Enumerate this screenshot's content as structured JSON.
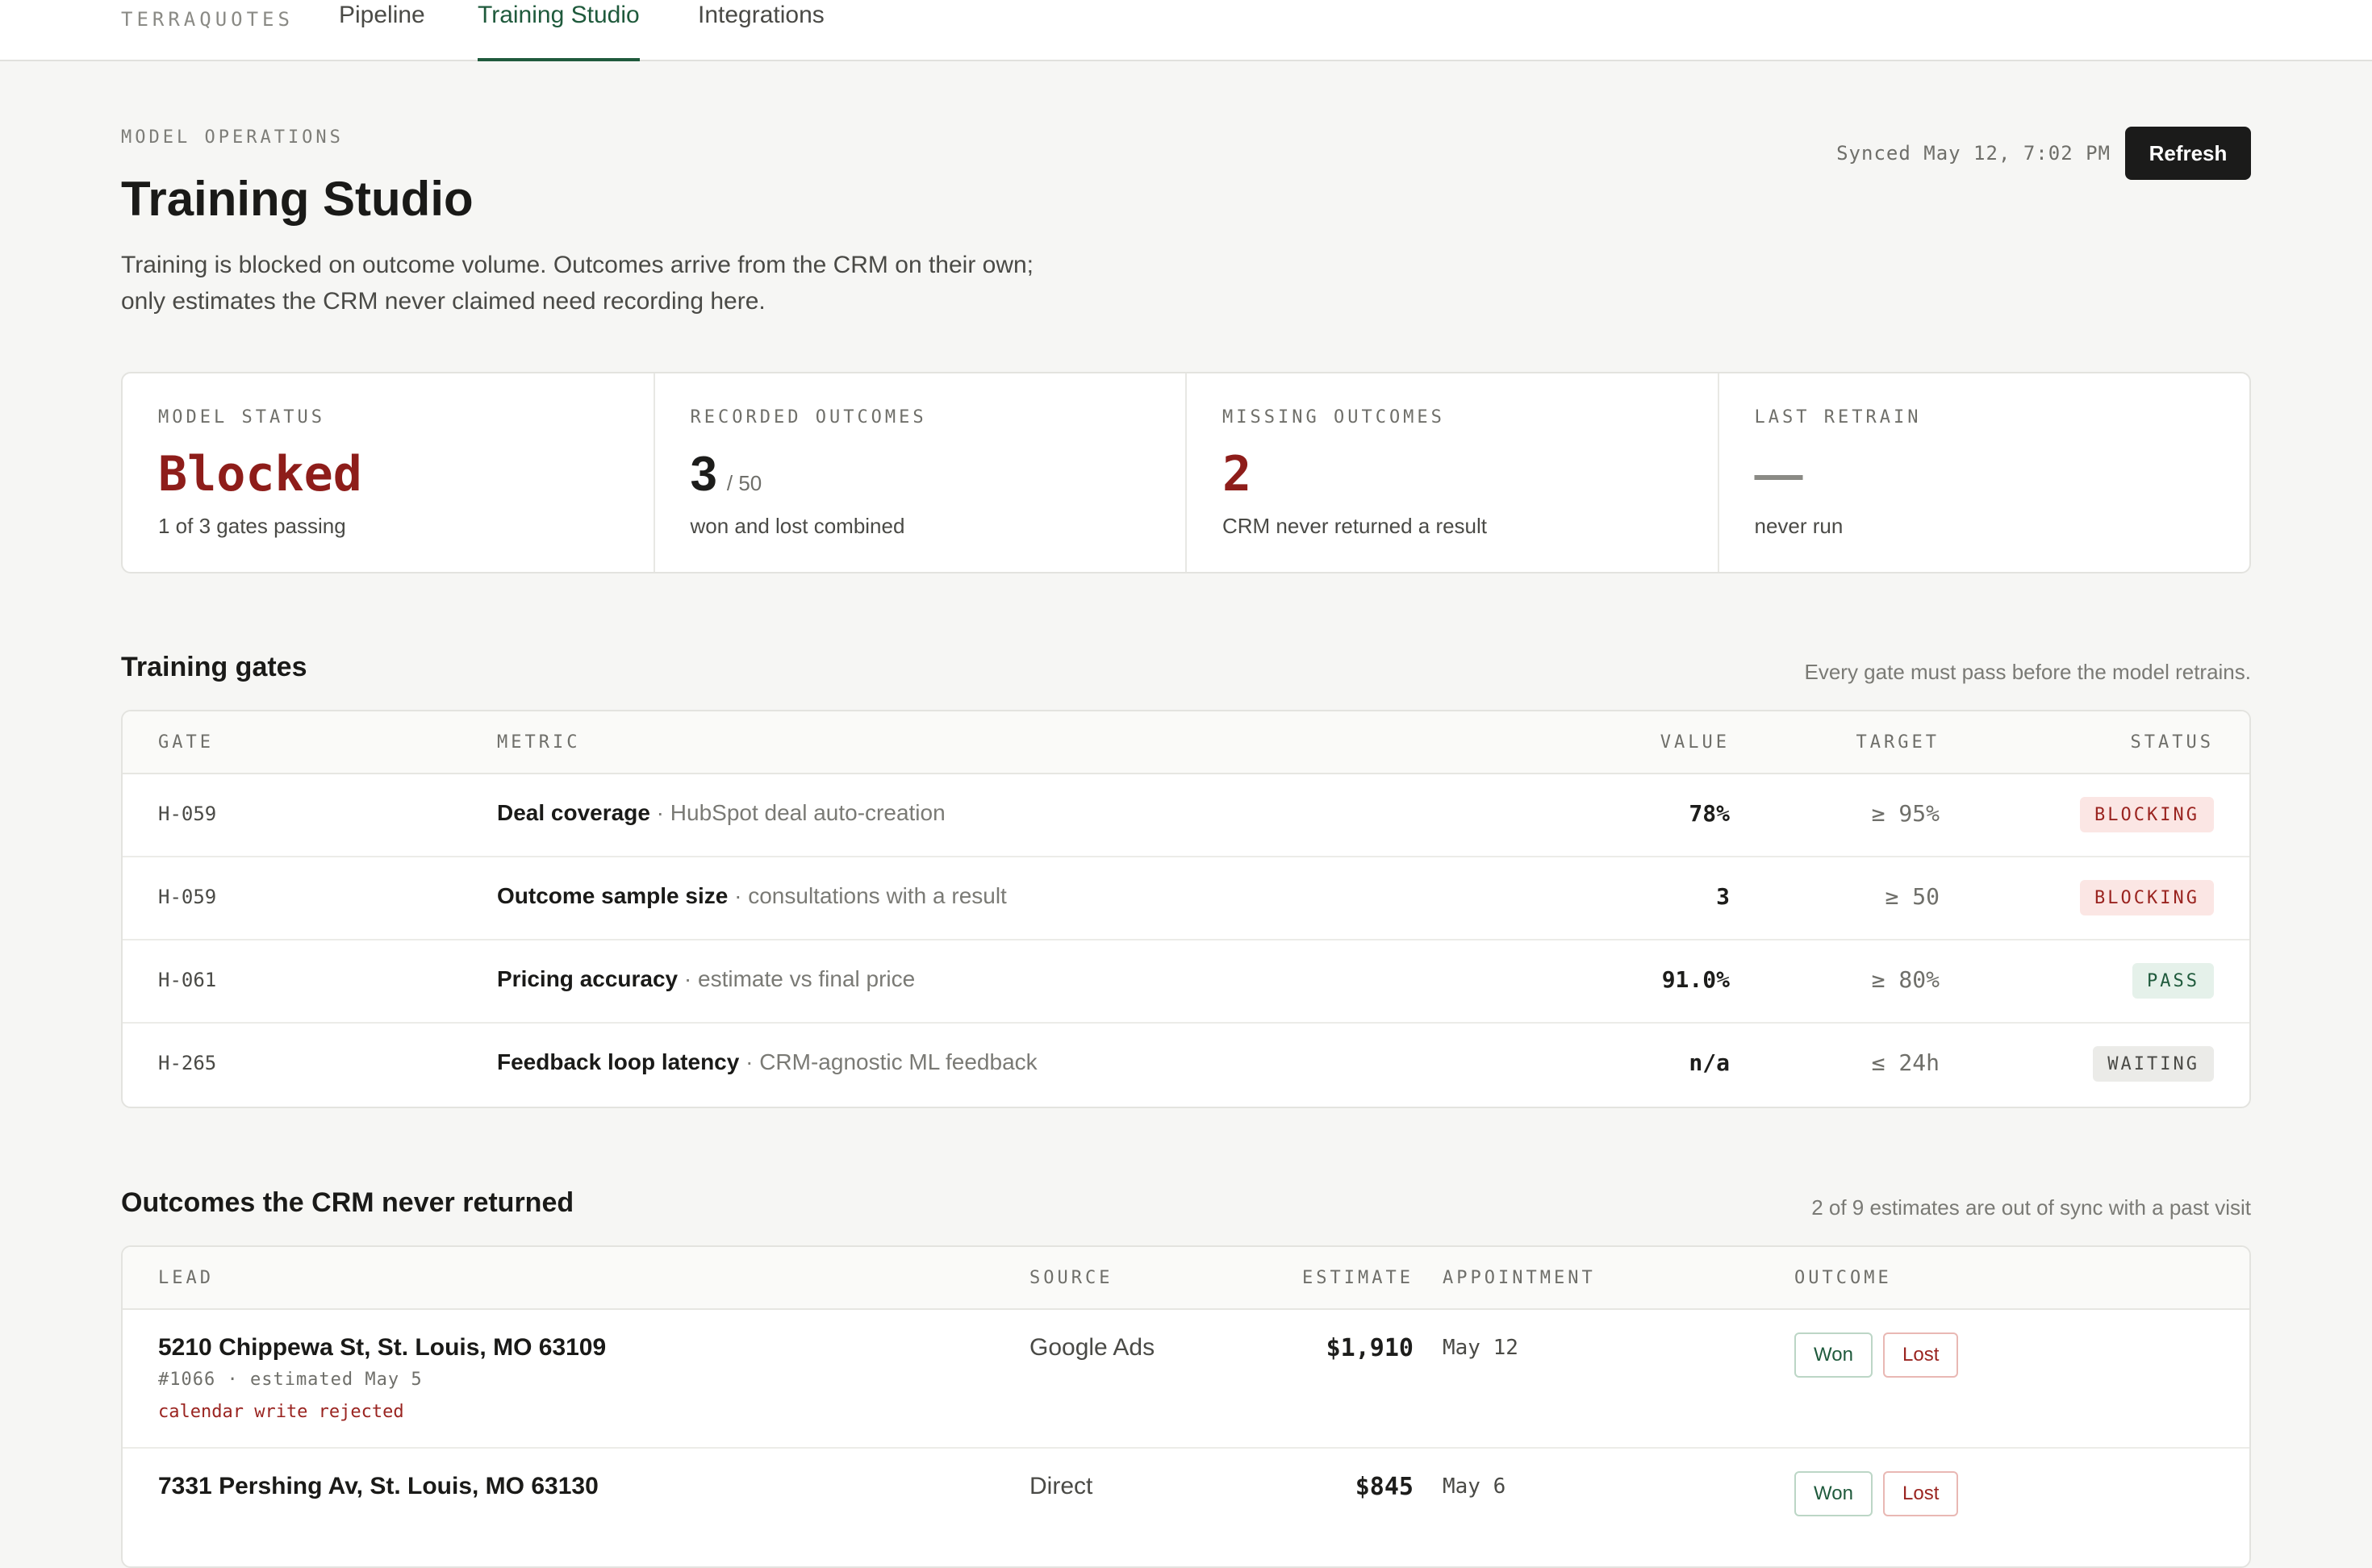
{
  "nav": {
    "brand": "TERRAQUOTES",
    "tabs": [
      {
        "label": "Pipeline",
        "active": false
      },
      {
        "label": "Training Studio",
        "active": true
      },
      {
        "label": "Integrations",
        "active": false
      }
    ]
  },
  "header": {
    "eyebrow": "MODEL OPERATIONS",
    "title": "Training Studio",
    "intro_line1": "Training is blocked on outcome volume. Outcomes arrive from the CRM on their own;",
    "intro_line2": "only estimates the CRM never claimed need recording here.",
    "synced": "Synced May 12, 7:02 PM",
    "refresh_label": "Refresh"
  },
  "stats": [
    {
      "label": "MODEL STATUS",
      "value": "Blocked",
      "suffix": "",
      "note": "1 of 3 gates passing",
      "color": "#8e1d1a"
    },
    {
      "label": "RECORDED OUTCOMES",
      "value": "3",
      "suffix": "/ 50",
      "note": "won and lost combined",
      "color": "#1a1a18"
    },
    {
      "label": "MISSING OUTCOMES",
      "value": "2",
      "suffix": "",
      "note": "CRM never returned a result",
      "color": "#8e1d1a"
    },
    {
      "label": "LAST RETRAIN",
      "value": "—",
      "suffix": "",
      "note": "never run",
      "color": "#8a8a85"
    }
  ],
  "gates": {
    "title": "Training gates",
    "hint": "Every gate must pass before the model retrains.",
    "columns": {
      "gate": "GATE",
      "metric": "METRIC",
      "value": "VALUE",
      "target": "TARGET",
      "status": "STATUS"
    },
    "rows": [
      {
        "id": "H-059",
        "metric": "Deal coverage",
        "desc": "· HubSpot deal auto-creation",
        "value": "78%",
        "target": "≥ 95%",
        "status": "BLOCKING",
        "status_kind": "blocking"
      },
      {
        "id": "H-059",
        "metric": "Outcome sample size",
        "desc": "· consultations with a result",
        "value": "3",
        "target": "≥ 50",
        "status": "BLOCKING",
        "status_kind": "blocking"
      },
      {
        "id": "H-061",
        "metric": "Pricing accuracy",
        "desc": "· estimate vs final price",
        "value": "91.0%",
        "target": "≥ 80%",
        "status": "PASS",
        "status_kind": "pass"
      },
      {
        "id": "H-265",
        "metric": "Feedback loop latency",
        "desc": "· CRM-agnostic ML feedback",
        "value": "n/a",
        "target": "≤ 24h",
        "status": "WAITING",
        "status_kind": "waiting"
      }
    ]
  },
  "outcomes": {
    "title": "Outcomes the CRM never returned",
    "hint": "2 of 9 estimates are out of sync with a past visit",
    "columns": {
      "lead": "LEAD",
      "source": "SOURCE",
      "estimate": "ESTIMATE",
      "appointment": "APPOINTMENT",
      "outcome": "OUTCOME"
    },
    "rows": [
      {
        "address": "5210 Chippewa St, St. Louis, MO 63109",
        "meta": "#1066 · estimated May 5",
        "error": "calendar write rejected",
        "source": "Google Ads",
        "estimate": "$1,910",
        "appointment": "May 12",
        "won_label": "Won",
        "lost_label": "Lost"
      },
      {
        "address": "7331 Pershing Av, St. Louis, MO 63130",
        "meta": "",
        "error": "",
        "source": "Direct",
        "estimate": "$845",
        "appointment": "May 6",
        "won_label": "Won",
        "lost_label": "Lost"
      }
    ]
  }
}
